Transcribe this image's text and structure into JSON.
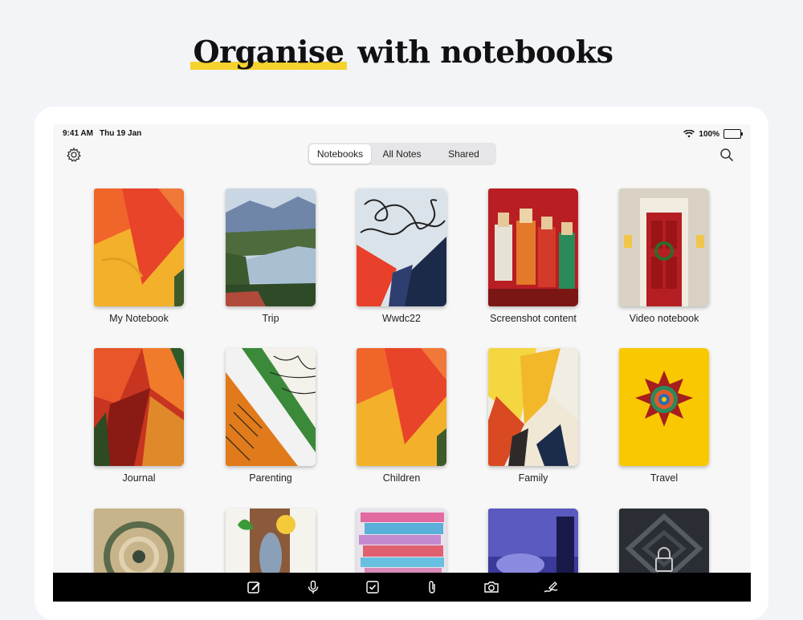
{
  "headline": {
    "highlight": "Organise",
    "rest": " with notebooks"
  },
  "status_bar": {
    "time": "9:41 AM",
    "date": "Thu 19 Jan",
    "battery": "100%"
  },
  "tabs": [
    {
      "label": "Notebooks",
      "active": true
    },
    {
      "label": "All Notes",
      "active": false
    },
    {
      "label": "Shared",
      "active": false
    }
  ],
  "notebooks": [
    {
      "title": "My Notebook",
      "cover": "orange-yellow-paint"
    },
    {
      "title": "Trip",
      "cover": "lake-landscape"
    },
    {
      "title": "Wwdc22",
      "cover": "squiggle-red-navy"
    },
    {
      "title": "Screenshot content",
      "cover": "puppets-red"
    },
    {
      "title": "Video notebook",
      "cover": "red-door"
    },
    {
      "title": "Journal",
      "cover": "abstract-red-green"
    },
    {
      "title": "Parenting",
      "cover": "orange-patterns"
    },
    {
      "title": "Children",
      "cover": "orange-yellow-paint"
    },
    {
      "title": "Family",
      "cover": "yellow-streaks"
    },
    {
      "title": "Travel",
      "cover": "yellow-mandala"
    },
    {
      "title": "",
      "cover": "swirl"
    },
    {
      "title": "",
      "cover": "fish-illustration"
    },
    {
      "title": "",
      "cover": "books-stack"
    },
    {
      "title": "",
      "cover": "blue-night"
    },
    {
      "title": "",
      "cover": "dark-locked"
    }
  ],
  "toolbar": [
    "compose-icon",
    "microphone-icon",
    "checklist-icon",
    "attachment-icon",
    "camera-icon",
    "sketch-icon"
  ],
  "colors": {
    "accent": "#f5d22e",
    "toolbar": "#000000",
    "background": "#f2f4f8"
  }
}
